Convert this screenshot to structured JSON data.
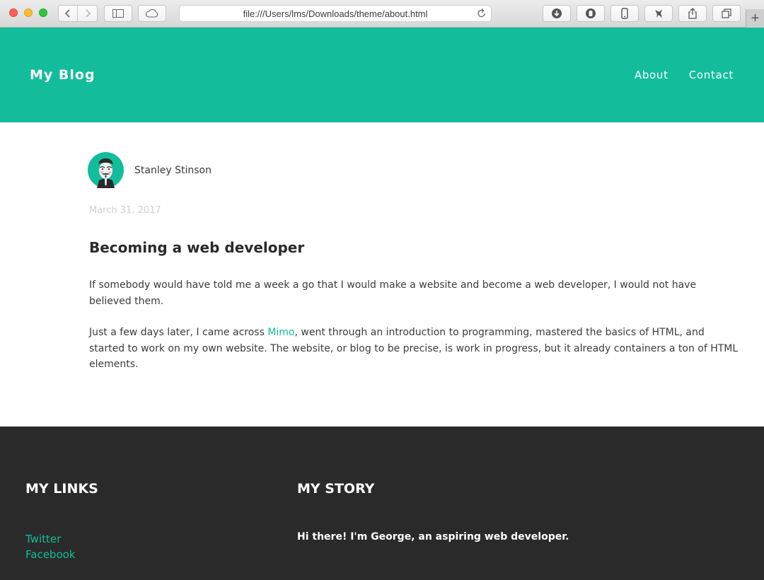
{
  "browser": {
    "url": "file:///Users/lms/Downloads/theme/about.html",
    "new_tab": "+"
  },
  "header": {
    "logo": "My Blog",
    "nav": [
      {
        "label": "About"
      },
      {
        "label": "Contact"
      }
    ],
    "background_color": "#13bd9b"
  },
  "post": {
    "author": "Stanley Stinson",
    "date": "March 31, 2017",
    "title": "Becoming a web developer",
    "paragraph1": "If somebody would have told me a week a go that I would make a website and become a web developer, I would not have believed them.",
    "paragraph2_before": "Just a few days later, I came across ",
    "paragraph2_link": "Mimo",
    "paragraph2_after": ", went through an introduction to programming, mastered the basics of HTML, and started to work on my own website. The website, or blog to be precise, is work in progress, but it already containers a ton of HTML elements."
  },
  "footer": {
    "links_heading": "MY LINKS",
    "story_heading": "MY STORY",
    "links": [
      {
        "label": "Twitter"
      },
      {
        "label": "Facebook"
      }
    ],
    "story_text": "Hi there! I'm George, an aspiring web developer.",
    "background_color": "#2a2a2a"
  }
}
